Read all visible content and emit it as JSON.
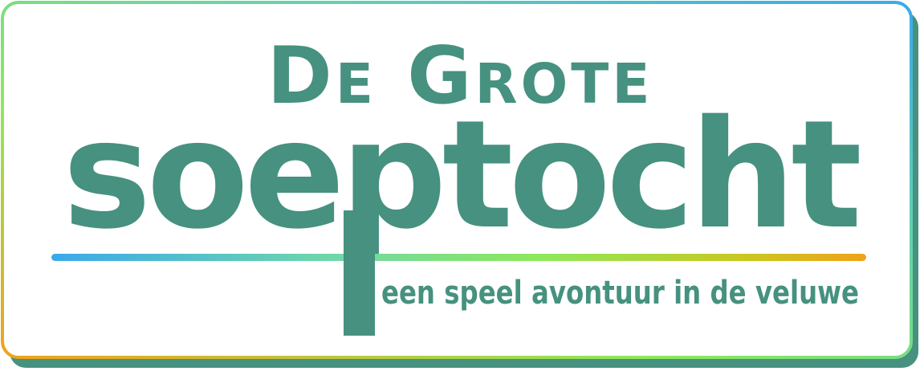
{
  "logo": {
    "title_line1": "De Grote",
    "title_line2": "soeptocht",
    "tagline": "een speel avontuur in de veluwe"
  },
  "colors": {
    "brand_green": "#46917f",
    "gradient_blue": "#3aa9ea",
    "gradient_teal": "#5fd0b4",
    "gradient_green": "#8ee85a",
    "gradient_orange": "#f0a21a",
    "background": "#ffffff"
  }
}
